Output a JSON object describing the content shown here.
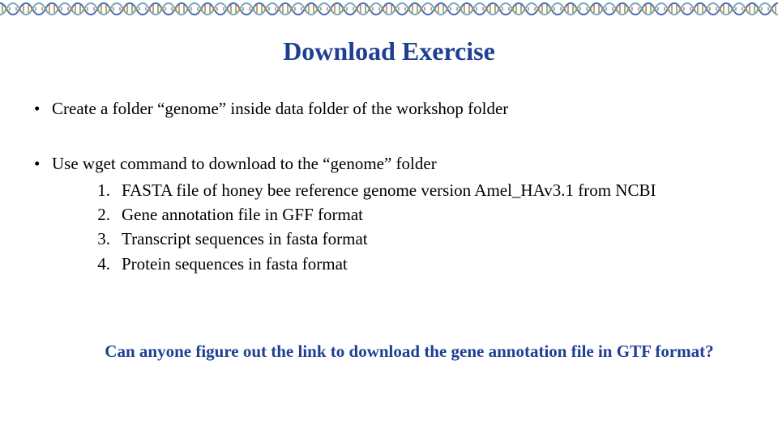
{
  "title": "Download Exercise",
  "bullets": {
    "b1": "Create a folder “genome” inside data folder of the workshop folder",
    "b2": "Use wget command to download to the “genome” folder",
    "items": {
      "n1": "1.",
      "t1": "FASTA file of honey bee reference genome version Amel_HAv3.1 from NCBI",
      "n2": "2.",
      "t2": "Gene annotation file in GFF format",
      "n3": "3.",
      "t3": "Transcript sequences in fasta format",
      "n4": "4.",
      "t4": "Protein sequences in fasta format"
    }
  },
  "question": "Can anyone figure out the link to download the gene annotation file in GTF format?",
  "dot": "•"
}
